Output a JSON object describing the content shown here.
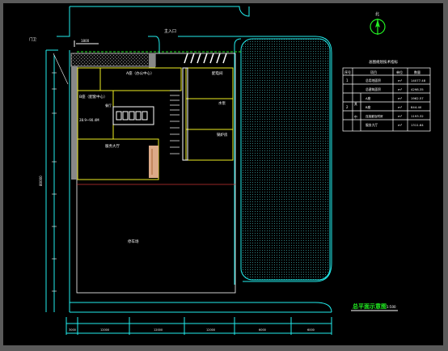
{
  "drawing": {
    "entrance_label": "主入口",
    "gate_label": "门卫",
    "dim_label_top": "1800",
    "building_a_label": "A座（办公中心）",
    "building_b_label": "B座（配套中心）",
    "canteen_label": "餐厅",
    "elev_label": "28.9~90.4M",
    "hall_label": "服务大厅",
    "right_labels": [
      "配电间",
      "水泵",
      "锅炉房"
    ],
    "yard_label": "停车场",
    "title": "总平面示意图",
    "scale": "1:500",
    "bottom_dims": [
      "3000",
      "12000",
      "12000",
      "12000",
      "6000",
      "6000"
    ],
    "left_dim": "80000",
    "compass": "北"
  },
  "table": {
    "title": "总图规划技术指标",
    "headers": [
      "序号",
      "项目",
      "单位",
      "数量"
    ],
    "rows": [
      {
        "no": "1",
        "item": "总用地面积",
        "sub": "",
        "unit": "m²",
        "qty": "14077.48"
      },
      {
        "no": "",
        "item": "总建筑面积",
        "sub": "",
        "unit": "m²",
        "qty": "4298.35"
      },
      {
        "no": "2",
        "item": "A座",
        "sub": "其",
        "unit": "m²",
        "qty": "1962.57"
      },
      {
        "no": "",
        "item": "B座",
        "sub": "",
        "unit": "m²",
        "qty": "844.40"
      },
      {
        "no": "",
        "item": "连接廊及附房",
        "sub": "中",
        "unit": "m²",
        "qty": "1193.32"
      },
      {
        "no": "",
        "item": "服务大厅",
        "sub": "",
        "unit": "m²",
        "qty": "1311.64"
      }
    ]
  }
}
